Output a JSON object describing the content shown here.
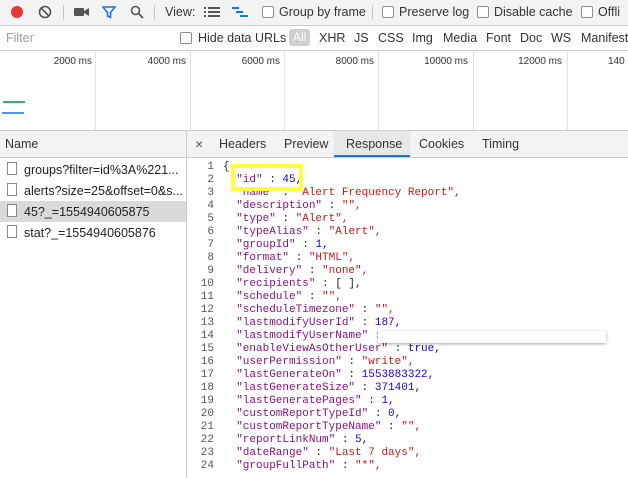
{
  "toolbar": {
    "view_label": "View:",
    "group_by_frame": "Group by frame",
    "preserve_log": "Preserve log",
    "disable_cache": "Disable cache",
    "offline": "Offli"
  },
  "filterbar": {
    "placeholder": "Filter",
    "hide_data_urls": "Hide data URLs",
    "all": "All",
    "types": [
      "XHR",
      "JS",
      "CSS",
      "Img",
      "Media",
      "Font",
      "Doc",
      "WS",
      "Manifest"
    ]
  },
  "timeline": {
    "ticks": [
      "2000 ms",
      "4000 ms",
      "6000 ms",
      "8000 ms",
      "10000 ms",
      "12000 ms",
      "140"
    ]
  },
  "requests": {
    "header": "Name",
    "items": [
      {
        "name": "groups?filter=id%3A%221..."
      },
      {
        "name": "alerts?size=25&offset=0&s..."
      },
      {
        "name": "45?_=1554940605875"
      },
      {
        "name": "stat?_=1554940605876"
      }
    ]
  },
  "tabs": {
    "close": "×",
    "items": [
      "Headers",
      "Preview",
      "Response",
      "Cookies",
      "Timing"
    ],
    "active": "Response"
  },
  "response": {
    "lines": [
      {
        "n": "1",
        "text": "{"
      },
      {
        "n": "2",
        "text": "\"id\" : 45,"
      },
      {
        "n": "3",
        "text": "\"name\" : \"Alert Frequency Report\","
      },
      {
        "n": "4",
        "text": "\"description\" : \"\","
      },
      {
        "n": "5",
        "text": "\"type\" : \"Alert\","
      },
      {
        "n": "6",
        "text": "\"typeAlias\" : \"Alert\","
      },
      {
        "n": "7",
        "text": "\"groupId\" : 1,"
      },
      {
        "n": "8",
        "text": "\"format\" : \"HTML\","
      },
      {
        "n": "9",
        "text": "\"delivery\" : \"none\","
      },
      {
        "n": "10",
        "text": "\"recipients\" : [ ],"
      },
      {
        "n": "11",
        "text": "\"schedule\" : \"\","
      },
      {
        "n": "12",
        "text": "\"scheduleTimezone\" : \"\","
      },
      {
        "n": "13",
        "text": "\"lastmodifyUserId\" : 187,"
      },
      {
        "n": "14",
        "text": "\"lastmodifyUserName\" :"
      },
      {
        "n": "15",
        "text": "\"enableViewAsOtherUser\" : true,"
      },
      {
        "n": "16",
        "text": "\"userPermission\" : \"write\","
      },
      {
        "n": "17",
        "text": "\"lastGenerateOn\" : 1553883322,"
      },
      {
        "n": "18",
        "text": "\"lastGenerateSize\" : 371401,"
      },
      {
        "n": "19",
        "text": "\"lastGeneratePages\" : 1,"
      },
      {
        "n": "20",
        "text": "\"customReportTypeId\" : 0,"
      },
      {
        "n": "21",
        "text": "\"customReportTypeName\" : \"\","
      },
      {
        "n": "22",
        "text": "\"reportLinkNum\" : 5,"
      },
      {
        "n": "23",
        "text": "\"dateRange\" : \"Last 7 days\","
      },
      {
        "n": "24",
        "text": "\"groupFullPath\" : \"*\","
      }
    ]
  },
  "colors": {
    "record_red": "#e53935",
    "filter_blue": "#1a73e8",
    "highlight_yellow": "#ffff3b",
    "waterfall_green": "#31b36b",
    "waterfall_blue": "#4d90fe"
  }
}
